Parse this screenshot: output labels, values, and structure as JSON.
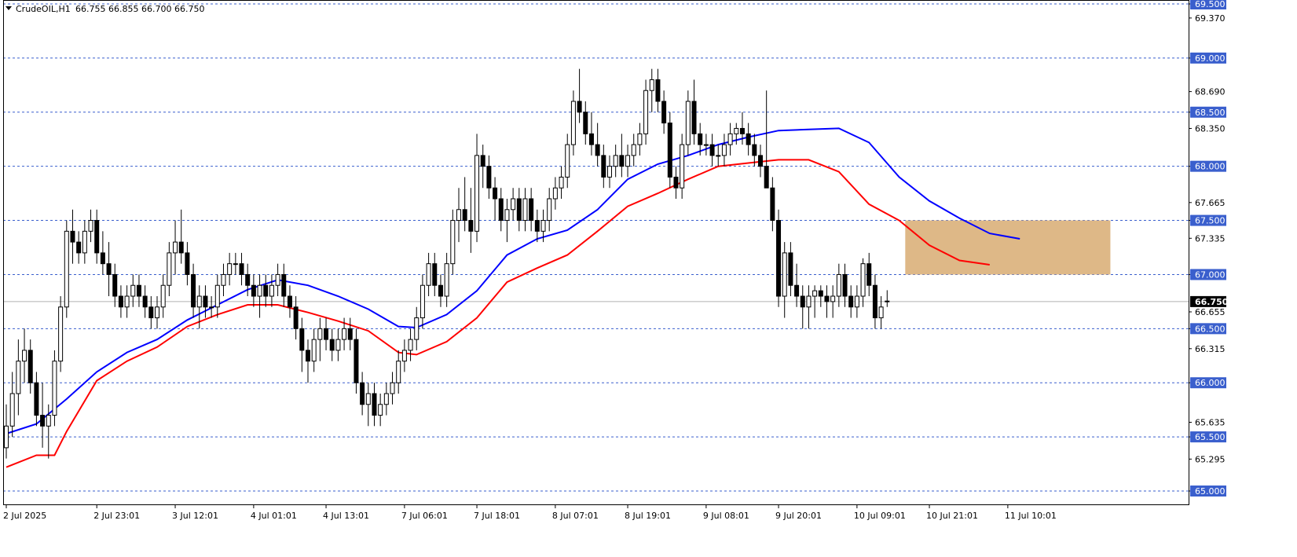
{
  "header": {
    "symbol": "CrudeOIL,H1",
    "ohlc": "66.755 66.855 66.700 66.750"
  },
  "chart_data": {
    "type": "candlestick",
    "symbol": "CrudeOIL",
    "timeframe": "H1",
    "ylim": [
      64.98,
      69.52
    ],
    "price_ticks": [
      "69.500",
      "69.370",
      "69.000",
      "68.690",
      "68.500",
      "68.350",
      "68.000",
      "67.665",
      "67.500",
      "67.335",
      "67.000",
      "66.750",
      "66.655",
      "66.500",
      "66.315",
      "66.000",
      "65.635",
      "65.500",
      "65.295",
      "65.000"
    ],
    "highlighted_ticks": [
      "69.500",
      "69.000",
      "68.500",
      "68.000",
      "67.500",
      "67.000",
      "66.500",
      "66.000",
      "65.500",
      "65.000"
    ],
    "level_lines": [
      69.5,
      69.0,
      68.5,
      68.0,
      67.5,
      67.0,
      66.5,
      66.0,
      65.5,
      65.0
    ],
    "current_price": 66.75,
    "current_price_label": "66.750",
    "time_labels": [
      {
        "label": "2 Jul 2025",
        "bar": 0
      },
      {
        "label": "2 Jul 23:01",
        "bar": 15
      },
      {
        "label": "3 Jul 12:01",
        "bar": 28
      },
      {
        "label": "4 Jul 01:01",
        "bar": 41
      },
      {
        "label": "4 Jul 13:01",
        "bar": 53
      },
      {
        "label": "7 Jul 06:01",
        "bar": 66
      },
      {
        "label": "7 Jul 18:01",
        "bar": 78
      },
      {
        "label": "8 Jul 07:01",
        "bar": 91
      },
      {
        "label": "8 Jul 19:01",
        "bar": 103
      },
      {
        "label": "9 Jul 08:01",
        "bar": 116
      },
      {
        "label": "9 Jul 20:01",
        "bar": 128
      },
      {
        "label": "10 Jul 09:01",
        "bar": 141
      },
      {
        "label": "10 Jul 21:01",
        "bar": 153
      },
      {
        "label": "11 Jul 10:01",
        "bar": 166
      }
    ],
    "zone": {
      "from_bar": 149,
      "to_bar": 183,
      "low": 67.0,
      "high": 67.5,
      "color": "#deb887"
    },
    "series": [
      {
        "type": "ma",
        "color": "#0000ff",
        "points": [
          [
            0,
            65.53
          ],
          [
            5,
            65.62
          ],
          [
            10,
            65.85
          ],
          [
            15,
            66.1
          ],
          [
            20,
            66.28
          ],
          [
            25,
            66.4
          ],
          [
            30,
            66.58
          ],
          [
            35,
            66.72
          ],
          [
            40,
            66.86
          ],
          [
            45,
            66.95
          ],
          [
            50,
            66.9
          ],
          [
            55,
            66.8
          ],
          [
            60,
            66.68
          ],
          [
            65,
            66.52
          ],
          [
            68,
            66.51
          ],
          [
            73,
            66.63
          ],
          [
            78,
            66.85
          ],
          [
            83,
            67.18
          ],
          [
            88,
            67.33
          ],
          [
            93,
            67.41
          ],
          [
            98,
            67.6
          ],
          [
            103,
            67.88
          ],
          [
            108,
            68.02
          ],
          [
            113,
            68.1
          ],
          [
            118,
            68.2
          ],
          [
            123,
            68.27
          ],
          [
            128,
            68.33
          ],
          [
            133,
            68.34
          ],
          [
            138,
            68.35
          ],
          [
            143,
            68.22
          ],
          [
            148,
            67.9
          ],
          [
            153,
            67.68
          ],
          [
            158,
            67.52
          ],
          [
            163,
            67.38
          ],
          [
            168,
            67.33
          ]
        ]
      },
      {
        "type": "ma",
        "color": "#ff0000",
        "points": [
          [
            0,
            65.22
          ],
          [
            5,
            65.33
          ],
          [
            8,
            65.33
          ],
          [
            10,
            65.55
          ],
          [
            15,
            66.02
          ],
          [
            20,
            66.2
          ],
          [
            25,
            66.33
          ],
          [
            30,
            66.52
          ],
          [
            35,
            66.63
          ],
          [
            40,
            66.72
          ],
          [
            45,
            66.72
          ],
          [
            50,
            66.65
          ],
          [
            55,
            66.57
          ],
          [
            60,
            66.48
          ],
          [
            65,
            66.28
          ],
          [
            68,
            66.26
          ],
          [
            73,
            66.38
          ],
          [
            78,
            66.6
          ],
          [
            83,
            66.93
          ],
          [
            88,
            67.06
          ],
          [
            93,
            67.18
          ],
          [
            98,
            67.4
          ],
          [
            103,
            67.63
          ],
          [
            108,
            67.75
          ],
          [
            113,
            67.88
          ],
          [
            118,
            68.0
          ],
          [
            123,
            68.03
          ],
          [
            128,
            68.06
          ],
          [
            133,
            68.06
          ],
          [
            138,
            67.95
          ],
          [
            143,
            67.65
          ],
          [
            148,
            67.5
          ],
          [
            153,
            67.27
          ],
          [
            158,
            67.13
          ],
          [
            163,
            67.09
          ]
        ]
      }
    ],
    "candles": [
      [
        65.4,
        65.8,
        65.3,
        65.6
      ],
      [
        65.6,
        66.1,
        65.5,
        65.9
      ],
      [
        65.9,
        66.4,
        65.7,
        66.2
      ],
      [
        66.2,
        66.5,
        66.0,
        66.3
      ],
      [
        66.3,
        66.4,
        65.9,
        66.0
      ],
      [
        66.0,
        66.1,
        65.6,
        65.7
      ],
      [
        65.7,
        66.0,
        65.4,
        65.6
      ],
      [
        65.6,
        65.8,
        65.3,
        65.7
      ],
      [
        65.7,
        66.3,
        65.6,
        66.2
      ],
      [
        66.2,
        66.8,
        66.1,
        66.7
      ],
      [
        66.7,
        67.5,
        66.6,
        67.4
      ],
      [
        67.4,
        67.6,
        67.1,
        67.3
      ],
      [
        67.3,
        67.4,
        67.1,
        67.2
      ],
      [
        67.2,
        67.5,
        67.1,
        67.4
      ],
      [
        67.4,
        67.6,
        67.3,
        67.5
      ],
      [
        67.5,
        67.6,
        67.1,
        67.2
      ],
      [
        67.2,
        67.4,
        67.0,
        67.1
      ],
      [
        67.1,
        67.3,
        66.8,
        67.0
      ],
      [
        67.0,
        67.1,
        66.7,
        66.8
      ],
      [
        66.8,
        66.9,
        66.6,
        66.7
      ],
      [
        66.7,
        66.9,
        66.6,
        66.8
      ],
      [
        66.8,
        67.0,
        66.7,
        66.9
      ],
      [
        66.9,
        67.0,
        66.7,
        66.8
      ],
      [
        66.8,
        66.9,
        66.6,
        66.7
      ],
      [
        66.7,
        66.8,
        66.5,
        66.6
      ],
      [
        66.6,
        66.8,
        66.5,
        66.7
      ],
      [
        66.7,
        67.0,
        66.6,
        66.9
      ],
      [
        66.9,
        67.3,
        66.8,
        67.2
      ],
      [
        67.2,
        67.5,
        67.0,
        67.3
      ],
      [
        67.3,
        67.6,
        67.1,
        67.2
      ],
      [
        67.2,
        67.3,
        66.9,
        67.0
      ],
      [
        67.0,
        67.1,
        66.6,
        66.7
      ],
      [
        66.7,
        66.9,
        66.5,
        66.8
      ],
      [
        66.8,
        66.9,
        66.6,
        66.7
      ],
      [
        66.7,
        66.8,
        66.6,
        66.7
      ],
      [
        66.7,
        67.0,
        66.6,
        66.9
      ],
      [
        66.9,
        67.1,
        66.8,
        67.0
      ],
      [
        67.0,
        67.2,
        66.9,
        67.1
      ],
      [
        67.1,
        67.2,
        67.0,
        67.1
      ],
      [
        67.1,
        67.2,
        66.9,
        67.0
      ],
      [
        67.0,
        67.1,
        66.8,
        66.9
      ],
      [
        66.9,
        67.0,
        66.7,
        66.8
      ],
      [
        66.8,
        67.0,
        66.6,
        66.9
      ],
      [
        66.9,
        67.0,
        66.7,
        66.8
      ],
      [
        66.8,
        67.0,
        66.7,
        66.9
      ],
      [
        66.9,
        67.1,
        66.8,
        67.0
      ],
      [
        67.0,
        67.1,
        66.7,
        66.8
      ],
      [
        66.8,
        66.9,
        66.6,
        66.7
      ],
      [
        66.7,
        66.8,
        66.4,
        66.5
      ],
      [
        66.5,
        66.6,
        66.1,
        66.3
      ],
      [
        66.3,
        66.4,
        66.0,
        66.2
      ],
      [
        66.2,
        66.5,
        66.1,
        66.4
      ],
      [
        66.4,
        66.6,
        66.2,
        66.5
      ],
      [
        66.5,
        66.6,
        66.3,
        66.4
      ],
      [
        66.4,
        66.5,
        66.2,
        66.3
      ],
      [
        66.3,
        66.5,
        66.2,
        66.4
      ],
      [
        66.4,
        66.6,
        66.3,
        66.5
      ],
      [
        66.5,
        66.6,
        66.3,
        66.4
      ],
      [
        66.4,
        66.5,
        65.9,
        66.0
      ],
      [
        66.0,
        66.1,
        65.7,
        65.8
      ],
      [
        65.8,
        66.0,
        65.6,
        65.9
      ],
      [
        65.9,
        66.0,
        65.6,
        65.7
      ],
      [
        65.7,
        65.9,
        65.6,
        65.8
      ],
      [
        65.8,
        66.0,
        65.7,
        65.9
      ],
      [
        65.9,
        66.1,
        65.8,
        66.0
      ],
      [
        66.0,
        66.3,
        65.9,
        66.2
      ],
      [
        66.2,
        66.4,
        66.1,
        66.3
      ],
      [
        66.3,
        66.5,
        66.2,
        66.4
      ],
      [
        66.4,
        66.7,
        66.3,
        66.6
      ],
      [
        66.6,
        67.0,
        66.5,
        66.9
      ],
      [
        66.9,
        67.2,
        66.8,
        67.1
      ],
      [
        67.1,
        67.2,
        66.8,
        66.9
      ],
      [
        66.9,
        67.0,
        66.7,
        66.8
      ],
      [
        66.8,
        67.2,
        66.7,
        67.1
      ],
      [
        67.1,
        67.6,
        67.0,
        67.5
      ],
      [
        67.5,
        67.8,
        67.3,
        67.6
      ],
      [
        67.6,
        67.9,
        67.4,
        67.5
      ],
      [
        67.5,
        67.8,
        67.2,
        67.4
      ],
      [
        67.4,
        68.3,
        67.3,
        68.1
      ],
      [
        68.1,
        68.2,
        67.8,
        68.0
      ],
      [
        68.0,
        68.1,
        67.7,
        67.8
      ],
      [
        67.8,
        67.9,
        67.5,
        67.7
      ],
      [
        67.7,
        67.8,
        67.4,
        67.5
      ],
      [
        67.5,
        67.7,
        67.3,
        67.6
      ],
      [
        67.6,
        67.8,
        67.5,
        67.7
      ],
      [
        67.7,
        67.8,
        67.4,
        67.5
      ],
      [
        67.5,
        67.8,
        67.4,
        67.7
      ],
      [
        67.7,
        67.8,
        67.4,
        67.5
      ],
      [
        67.5,
        67.6,
        67.3,
        67.4
      ],
      [
        67.4,
        67.6,
        67.3,
        67.5
      ],
      [
        67.5,
        67.8,
        67.4,
        67.7
      ],
      [
        67.7,
        67.9,
        67.6,
        67.8
      ],
      [
        67.8,
        68.0,
        67.7,
        67.9
      ],
      [
        67.9,
        68.3,
        67.8,
        68.2
      ],
      [
        68.2,
        68.7,
        68.1,
        68.6
      ],
      [
        68.6,
        68.9,
        68.4,
        68.5
      ],
      [
        68.5,
        68.6,
        68.2,
        68.3
      ],
      [
        68.3,
        68.5,
        68.1,
        68.2
      ],
      [
        68.2,
        68.4,
        68.0,
        68.1
      ],
      [
        68.1,
        68.2,
        67.8,
        67.9
      ],
      [
        67.9,
        68.1,
        67.8,
        68.0
      ],
      [
        68.0,
        68.2,
        67.9,
        68.1
      ],
      [
        68.1,
        68.3,
        67.9,
        68.0
      ],
      [
        68.0,
        68.2,
        67.9,
        68.1
      ],
      [
        68.1,
        68.3,
        68.0,
        68.2
      ],
      [
        68.2,
        68.4,
        68.1,
        68.3
      ],
      [
        68.3,
        68.8,
        68.2,
        68.7
      ],
      [
        68.7,
        68.9,
        68.5,
        68.8
      ],
      [
        68.8,
        68.9,
        68.5,
        68.6
      ],
      [
        68.6,
        68.7,
        68.3,
        68.4
      ],
      [
        68.4,
        68.5,
        67.8,
        67.9
      ],
      [
        67.9,
        68.0,
        67.7,
        67.8
      ],
      [
        67.8,
        68.3,
        67.7,
        68.2
      ],
      [
        68.2,
        68.7,
        68.1,
        68.6
      ],
      [
        68.6,
        68.8,
        68.2,
        68.3
      ],
      [
        68.3,
        68.4,
        68.1,
        68.2
      ],
      [
        68.2,
        68.3,
        68.1,
        68.2
      ],
      [
        68.2,
        68.3,
        68.0,
        68.1
      ],
      [
        68.1,
        68.2,
        68.0,
        68.1
      ],
      [
        68.1,
        68.3,
        68.0,
        68.2
      ],
      [
        68.2,
        68.4,
        68.1,
        68.3
      ],
      [
        68.3,
        68.4,
        68.2,
        68.35
      ],
      [
        68.35,
        68.5,
        68.2,
        68.3
      ],
      [
        68.3,
        68.4,
        68.1,
        68.2
      ],
      [
        68.2,
        68.3,
        68.0,
        68.1
      ],
      [
        68.1,
        68.2,
        67.9,
        68.0
      ],
      [
        68.0,
        68.7,
        67.8,
        67.8
      ],
      [
        67.8,
        67.9,
        67.4,
        67.5
      ],
      [
        67.5,
        67.6,
        66.7,
        66.8
      ],
      [
        66.8,
        67.3,
        66.6,
        67.2
      ],
      [
        67.2,
        67.3,
        66.8,
        66.9
      ],
      [
        66.9,
        67.1,
        66.7,
        66.8
      ],
      [
        66.8,
        66.9,
        66.5,
        66.7
      ],
      [
        66.7,
        66.9,
        66.5,
        66.8
      ],
      [
        66.8,
        66.9,
        66.6,
        66.85
      ],
      [
        66.85,
        66.9,
        66.7,
        66.8
      ],
      [
        66.8,
        66.9,
        66.6,
        66.75
      ],
      [
        66.75,
        66.9,
        66.6,
        66.8
      ],
      [
        66.8,
        67.1,
        66.7,
        67.0
      ],
      [
        67.0,
        67.1,
        66.7,
        66.8
      ],
      [
        66.8,
        66.9,
        66.6,
        66.7
      ],
      [
        66.7,
        66.9,
        66.6,
        66.8
      ],
      [
        66.8,
        67.15,
        66.7,
        67.1
      ],
      [
        67.1,
        67.2,
        66.8,
        66.9
      ],
      [
        66.9,
        67.0,
        66.5,
        66.6
      ],
      [
        66.6,
        66.8,
        66.5,
        66.7
      ],
      [
        66.755,
        66.855,
        66.7,
        66.75
      ]
    ]
  }
}
